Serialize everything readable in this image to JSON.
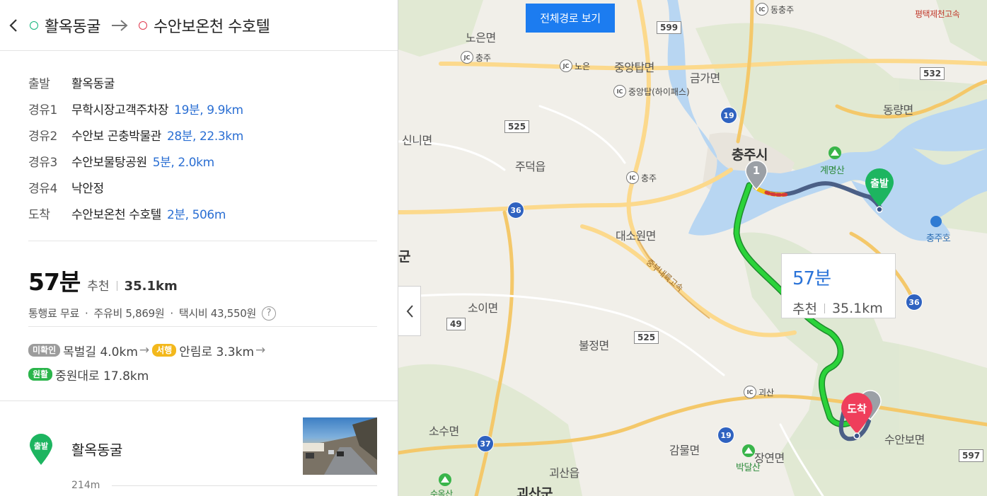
{
  "header": {
    "start": "활옥동굴",
    "end": "수안보온천 수호텔"
  },
  "waypoints": [
    {
      "label": "출발",
      "name": "활옥동굴",
      "meta": ""
    },
    {
      "label": "경유1",
      "name": "무학시장고객주차장",
      "meta": "19분, 9.9km"
    },
    {
      "label": "경유2",
      "name": "수안보 곤충박물관",
      "meta": "28분, 22.3km"
    },
    {
      "label": "경유3",
      "name": "수안보물탕공원",
      "meta": "5분, 2.0km"
    },
    {
      "label": "경유4",
      "name": "낙안정",
      "meta": ""
    },
    {
      "label": "도착",
      "name": "수안보온천 수호텔",
      "meta": "2분, 506m"
    }
  ],
  "summary": {
    "time": "57분",
    "tag": "추천",
    "distance": "35.1km",
    "toll": "통행료 무료",
    "fuel": "주유비 5,869원",
    "taxi": "택시비 43,550원",
    "help": "?"
  },
  "traffic": {
    "line1": [
      {
        "badge": "미확인",
        "color": "gray",
        "road": "목벌길 4.0km"
      },
      {
        "badge": "서행",
        "color": "yellow",
        "road": "안림로 3.3km"
      }
    ],
    "line2": [
      {
        "badge": "원활",
        "color": "green",
        "road": "중원대로 17.8km"
      }
    ]
  },
  "steps": {
    "start_pin": "출발",
    "start_name": "활옥동굴",
    "distance": "214m"
  },
  "map": {
    "full_route_button": "전체경로 보기",
    "callout_time": "57분",
    "callout_tag": "추천",
    "callout_distance": "35.1km",
    "start_marker": "출발",
    "end_marker": "도착",
    "waypoint_marker": "1",
    "places": {
      "noeunmyeon": "노은면",
      "noeun": "노은",
      "chungju_jc": "충주",
      "jungangtapmyeon": "중앙탑면",
      "jungangtap_ic": "중앙탑(하이패스)",
      "geumgamyeon": "금가면",
      "dongchungju": "동충주",
      "pyeongtaek": "평택제천고속",
      "dongnyangmyeon": "동량면",
      "sinnimyeon": "신니면",
      "judeokeup": "주덕읍",
      "chungju_si": "충주시",
      "chungju_ic": "충주",
      "gyemyeongsan": "계명산",
      "chungjuho": "충주호",
      "daesowonmyeon": "대소원면",
      "gun": "군",
      "soimyeon": "소이면",
      "jungbu_expressway": "중부내륙고속",
      "buljeongmyeon": "불정면",
      "goesan_ic": "괴산",
      "susumyeon": "소수면",
      "gammulmyeon": "감물면",
      "yeonmyeon": "장연면",
      "bakdalsan": "박달산",
      "suanbomyeon": "수안보면",
      "goesaneup": "괴산읍",
      "goesangun": "괴산군",
      "suoksan": "수옥산"
    },
    "roads": {
      "r599": "599",
      "r532": "532",
      "r525a": "525",
      "r525b": "525",
      "r49": "49",
      "r597": "597",
      "h19a": "19",
      "h19b": "19",
      "h36a": "36",
      "h36b": "36",
      "h37": "37"
    },
    "ic_marks": {
      "ic": "IC",
      "jc": "JC"
    }
  }
}
